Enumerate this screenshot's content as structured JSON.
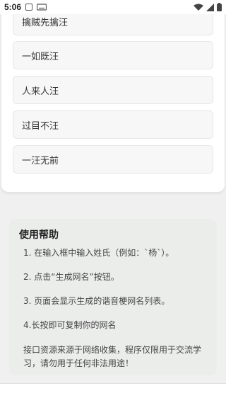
{
  "status_bar": {
    "time": "5:06",
    "icons": [
      "notification-a-icon",
      "keyboard-icon",
      "wifi-icon",
      "signal-icon",
      "battery-icon"
    ]
  },
  "results": [
    "擒贼先擒汪",
    "一如既汪",
    "人来人汪",
    "过目不汪",
    "一汪无前"
  ],
  "help": {
    "title": "使用帮助",
    "steps": [
      "1. 在输入框中输入姓氏（例如：`杨`）。",
      "2. 点击“生成网名”按钮。",
      "3. 页面会显示生成的谐音梗网名列表。",
      "4.长按即可复制你的网名"
    ],
    "disclaimer": "接口资源来源于网络收集，程序仅限用于交流学习，请勿用于任何非法用途！"
  }
}
